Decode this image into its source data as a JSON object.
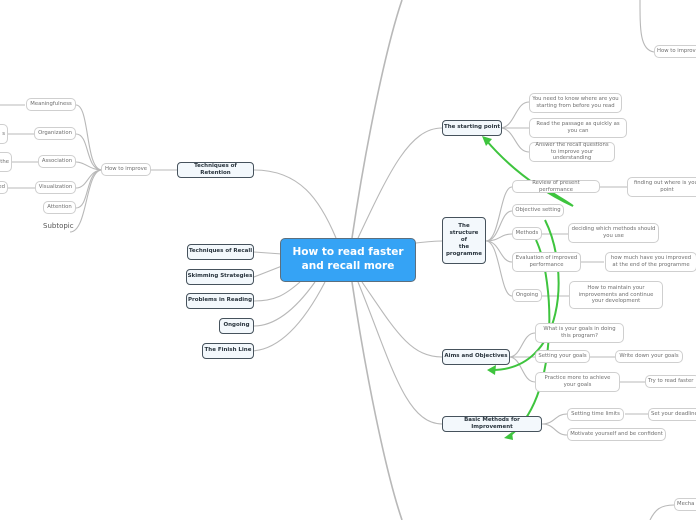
{
  "central": {
    "title": "How to read faster and recall more"
  },
  "left": {
    "retention": {
      "label": "Techniques of Retention",
      "how": "How to improve",
      "items": [
        "Meaningfulness",
        "Organization",
        "Association",
        "Visualization",
        "Attention",
        "Subtopic"
      ],
      "offscreen": [
        "s",
        "the",
        "ed"
      ]
    },
    "others": [
      "Techniques of Recall",
      "Skimming Strategies",
      "Problems in Reading",
      "Ongoing",
      "The Finish Line"
    ]
  },
  "right": {
    "starting_point": {
      "label": "The starting point",
      "items": [
        "You need to know where are you starting from before you read",
        "Read the passage as quickly as you can",
        "Answer the recall questions to improve your understanding"
      ]
    },
    "structure": {
      "label": "The structure of the programme",
      "label_lines": [
        "The",
        "structure",
        "of",
        "the",
        "programme"
      ],
      "items": [
        {
          "label": "Review of present performance",
          "detail": "finding out where is your point"
        },
        {
          "label": "Objective setting",
          "detail": ""
        },
        {
          "label": "Methods",
          "detail": "deciding which methods should you use"
        },
        {
          "label": "Evaluation of improved performance",
          "detail": "how much have you improved at the end of the programme"
        },
        {
          "label": "Ongoing",
          "detail": "How to maintain your improvements and continue your development"
        }
      ]
    },
    "aims": {
      "label": "Aims and Objectives",
      "items": [
        {
          "label": "What is your goals in doing this program?",
          "detail": ""
        },
        {
          "label": "Setting your goals",
          "detail": "Write down your goals"
        },
        {
          "label": "Practice more to achieve your goals",
          "detail": "Try to read faster"
        }
      ]
    },
    "basic": {
      "label": "Basic Methods for Improvement",
      "items": [
        {
          "label": "Setting time limits",
          "detail": "Set your deadline"
        },
        {
          "label": "Motivate yourself and be confident",
          "detail": ""
        }
      ]
    },
    "top_offscreen": "How to improve",
    "bottom_offscreen": "Mecha"
  },
  "colors": {
    "central": "#35a3f5",
    "relationship": "#3ec43e",
    "link": "#b5b5b5"
  }
}
